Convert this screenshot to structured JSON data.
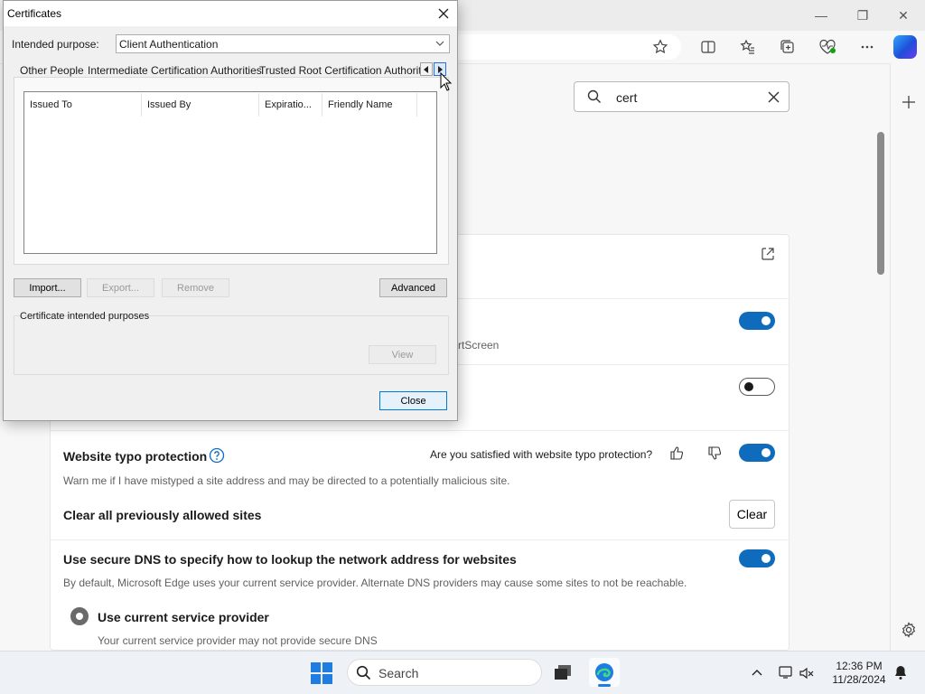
{
  "browser": {
    "window_controls": {
      "minimize": "—",
      "restore": "❐",
      "close": "✕"
    },
    "search": {
      "value": "cert"
    },
    "settings": {
      "smartscreen_fragment": "rtScreen",
      "typo_protection": {
        "title": "Website typo protection",
        "feedback_question": "Are you satisfied with website typo protection?",
        "description": "Warn me if I have mistyped a site address and may be directed to a potentially malicious site.",
        "toggle_on": true
      },
      "clear_allowed_sites": {
        "title": "Clear all previously allowed sites",
        "button": "Clear"
      },
      "secure_dns": {
        "title": "Use secure DNS to specify how to lookup the network address for websites",
        "description": "By default, Microsoft Edge uses your current service provider. Alternate DNS providers may cause some sites to not be reachable.",
        "toggle_on": true,
        "option": {
          "label": "Use current service provider",
          "description": "Your current service provider may not provide secure DNS"
        }
      },
      "toggle_1_on": true,
      "toggle_2_on": false
    }
  },
  "dialog": {
    "title": "Certificates",
    "intended_purpose_label": "Intended purpose:",
    "intended_purpose_value": "Client Authentication",
    "tabs": [
      "Other People",
      "Intermediate Certification Authorities",
      "Trusted Root Certification Authorities"
    ],
    "columns": [
      "Issued To",
      "Issued By",
      "Expiratio...",
      "Friendly Name"
    ],
    "buttons": {
      "import": "Import...",
      "export": "Export...",
      "remove": "Remove",
      "advanced": "Advanced",
      "view": "View",
      "close": "Close"
    },
    "group_label": "Certificate intended purposes"
  },
  "taskbar": {
    "search_placeholder": "Search",
    "time": "12:36 PM",
    "date": "11/28/2024"
  },
  "colors": {
    "accent": "#0f6cbd",
    "windows_blue": "#1f7ce0"
  }
}
